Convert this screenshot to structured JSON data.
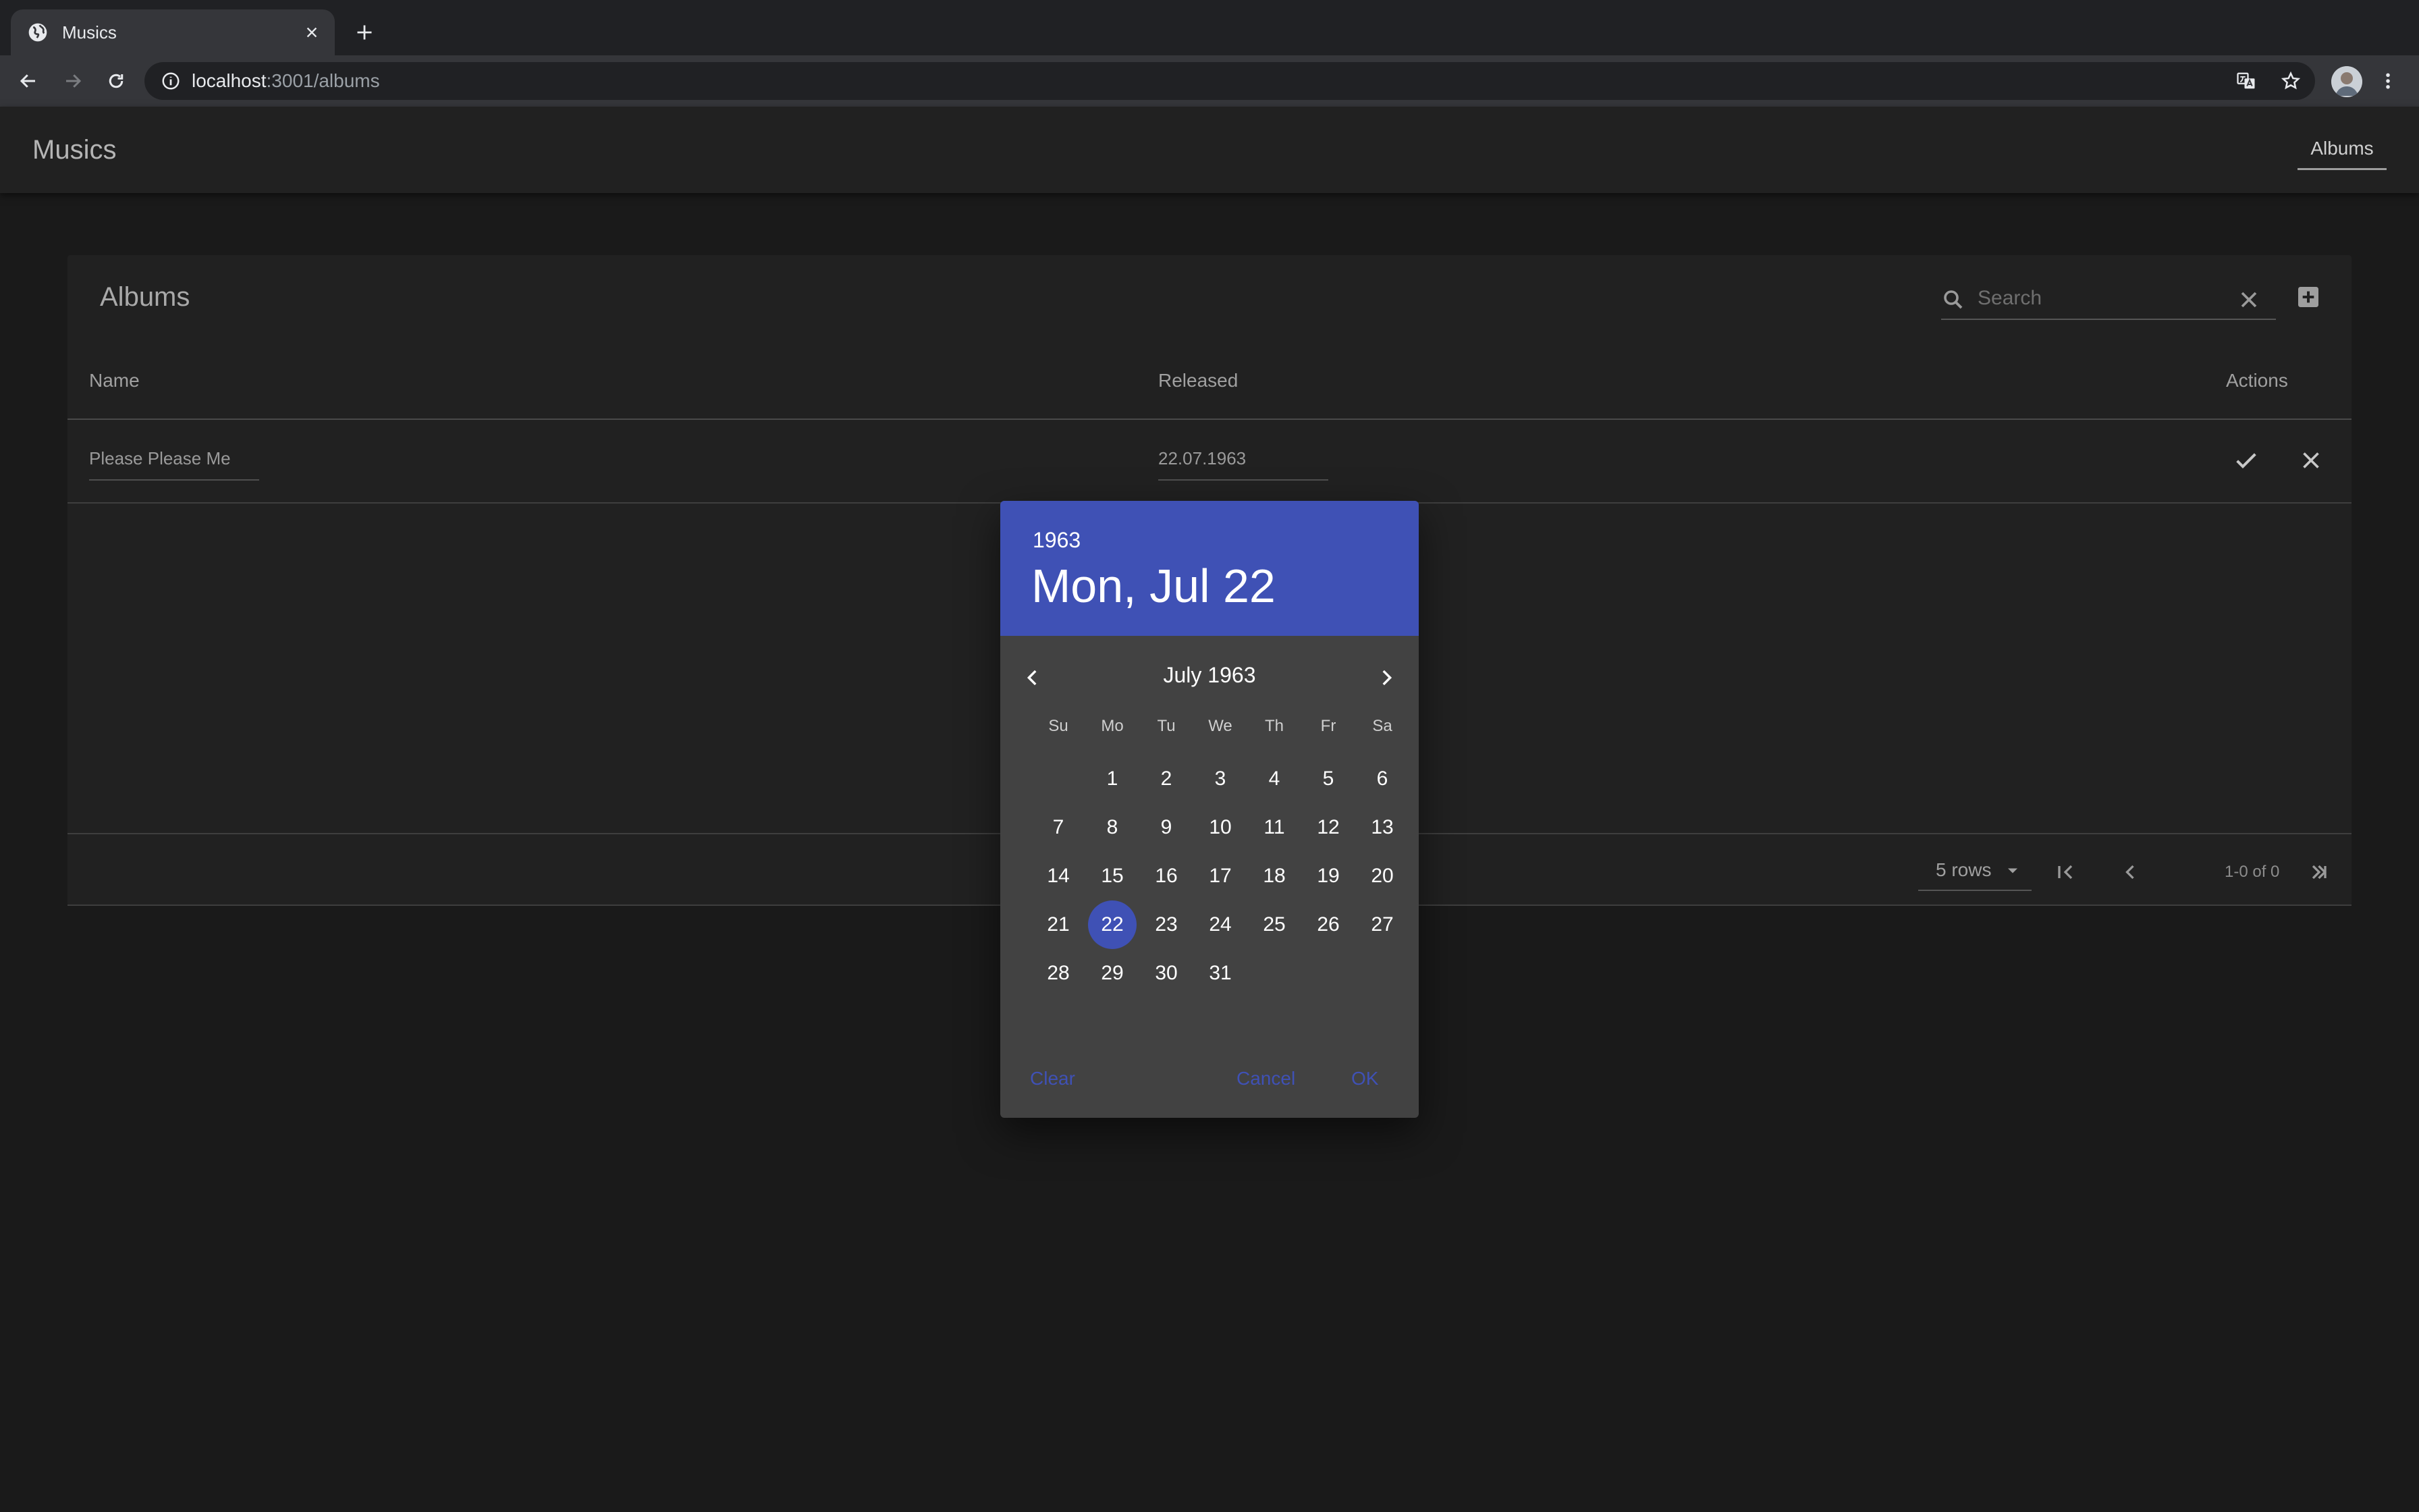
{
  "browser": {
    "tab_title": "Musics",
    "url_host": "localhost",
    "url_path": ":3001/albums"
  },
  "app": {
    "title": "Musics",
    "nav_tab": "Albums"
  },
  "table": {
    "title": "Albums",
    "search_placeholder": "Search",
    "columns": [
      "Name",
      "Released",
      "Actions"
    ],
    "edit_row": {
      "name": "Please Please Me",
      "released": "22.07.1963"
    },
    "pagination": {
      "rows_per_page": "5 rows",
      "range_label": "1-0 of 0"
    }
  },
  "date_picker": {
    "year": "1963",
    "selected_date_label": "Mon, Jul 22",
    "month_label": "July 1963",
    "weekdays": [
      "Su",
      "Mo",
      "Tu",
      "We",
      "Th",
      "Fr",
      "Sa"
    ],
    "first_weekday_index": 1,
    "days_in_month": 31,
    "selected_day": 22,
    "clear_label": "Clear",
    "cancel_label": "Cancel",
    "ok_label": "OK",
    "accent_color": "#3f51b5"
  },
  "icons": {
    "tab": [
      "globe-icon",
      "close-icon",
      "plus-icon"
    ],
    "toolbar": [
      "back-icon",
      "forward-icon",
      "reload-icon",
      "info-icon",
      "translate-icon",
      "star-icon",
      "menu-icon"
    ],
    "table": [
      "search-icon",
      "clear-icon",
      "add-box-icon",
      "check-icon",
      "close-icon",
      "chevron-down-icon",
      "first-page-icon",
      "chevron-left-icon",
      "chevron-right-icon",
      "last-page-icon"
    ]
  }
}
